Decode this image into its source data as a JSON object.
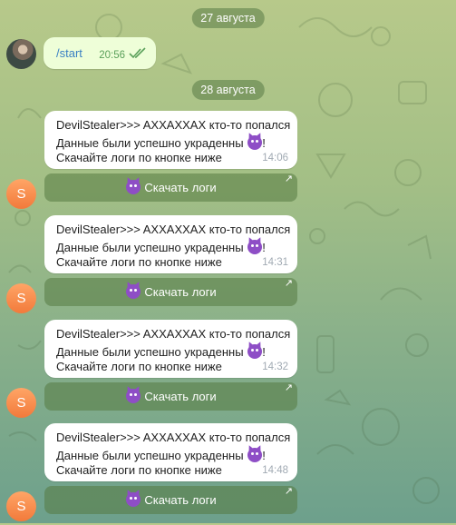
{
  "chat": {
    "date1": "27 августа",
    "date2": "28 августа",
    "outgoing": {
      "text": "/start",
      "time": "20:56"
    },
    "bot_initial": "S",
    "messages": [
      {
        "line1": "DevilStealer>>> AXXAXXAX кто-то попался",
        "line2": "Данные были успешно украденны",
        "line2_suffix": "!",
        "line3": "Скачайте логи по кнопке ниже",
        "time": "14:06",
        "button": "Скачать логи"
      },
      {
        "line1": "DevilStealer>>> AXXAXXAX кто-то попался",
        "line2": "Данные были успешно украденны",
        "line2_suffix": "!",
        "line3": "Скачайте логи по кнопке ниже",
        "time": "14:31",
        "button": "Скачать логи"
      },
      {
        "line1": "DevilStealer>>> AXXAXXAX кто-то попался",
        "line2": "Данные были успешно украденны",
        "line2_suffix": "!",
        "line3": "Скачайте логи по кнопке ниже",
        "time": "14:32",
        "button": "Скачать логи"
      },
      {
        "line1": "DevilStealer>>> AXXAXXAX кто-то попался",
        "line2": "Данные были успешно украденны",
        "line2_suffix": "!",
        "line3": "Скачайте логи по кнопке ниже",
        "time": "14:48",
        "button": "Скачать логи"
      }
    ]
  },
  "colors": {
    "outgoing_bubble": "#eefed8",
    "incoming_bubble": "#ffffff",
    "link": "#3a80c4",
    "avatar_orange": "#f27a3b",
    "devil_emoji": "#8e4ec6"
  },
  "icons": {
    "read_receipt": "double-check-icon",
    "button_emoji": "smiling-devil-icon",
    "button_corner": "arrow-up-right-icon"
  }
}
